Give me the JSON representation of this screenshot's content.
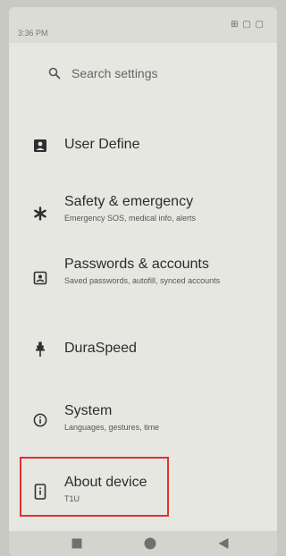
{
  "status_bar": {
    "time": "3:36 PM",
    "icons_text": "⊞ ▢ ▢"
  },
  "search": {
    "placeholder": "Search settings"
  },
  "settings_items": [
    {
      "icon": "user-define-icon",
      "title": "User Define",
      "subtitle": ""
    },
    {
      "icon": "asterisk-icon",
      "title": "Safety & emergency",
      "subtitle": "Emergency SOS, medical info, alerts"
    },
    {
      "icon": "account-box-icon",
      "title": "Passwords & accounts",
      "subtitle": "Saved passwords, autofill, synced accounts"
    },
    {
      "icon": "speed-pin-icon",
      "title": "DuraSpeed",
      "subtitle": ""
    },
    {
      "icon": "info-icon",
      "title": "System",
      "subtitle": "Languages, gestures, time"
    },
    {
      "icon": "phone-info-icon",
      "title": "About device",
      "subtitle": "T1U"
    }
  ],
  "highlight_color": "#e0322e",
  "nav_bar": {
    "buttons": [
      "recent-apps",
      "home",
      "back"
    ]
  }
}
